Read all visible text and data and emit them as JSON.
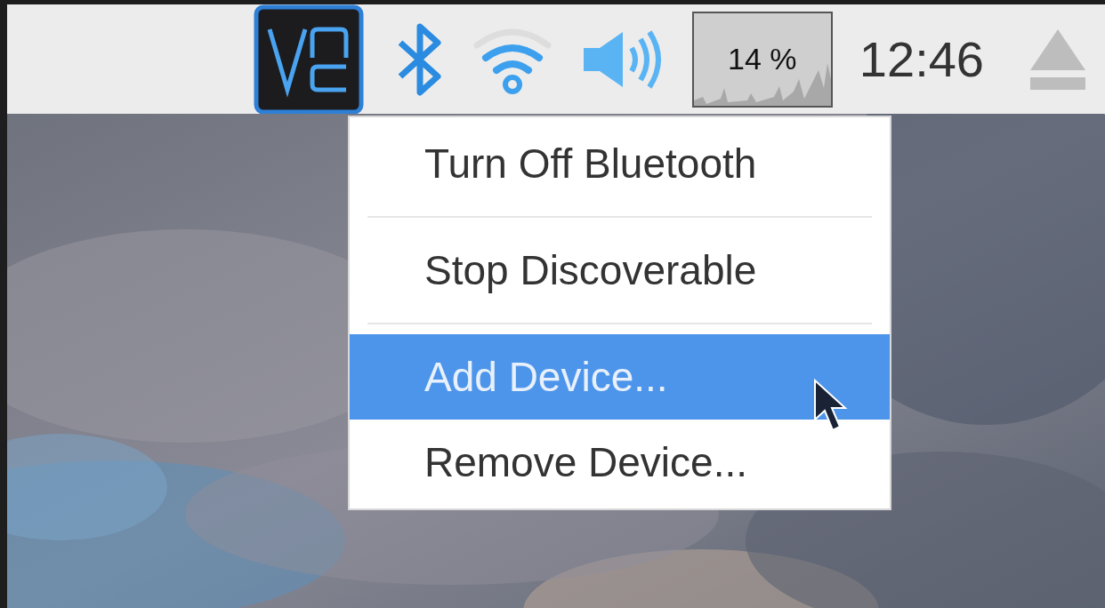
{
  "taskbar": {
    "cpu_monitor": {
      "reading": "14 %"
    },
    "clock": "12:46"
  },
  "bluetooth_menu": {
    "items": [
      {
        "kind": "item",
        "label": "Turn Off Bluetooth",
        "selected": false
      },
      {
        "kind": "separator"
      },
      {
        "kind": "item",
        "label": "Stop Discoverable",
        "selected": false
      },
      {
        "kind": "separator"
      },
      {
        "kind": "item",
        "label": "Add Device...",
        "selected": true
      },
      {
        "kind": "item",
        "label": "Remove Device...",
        "selected": false
      }
    ]
  }
}
